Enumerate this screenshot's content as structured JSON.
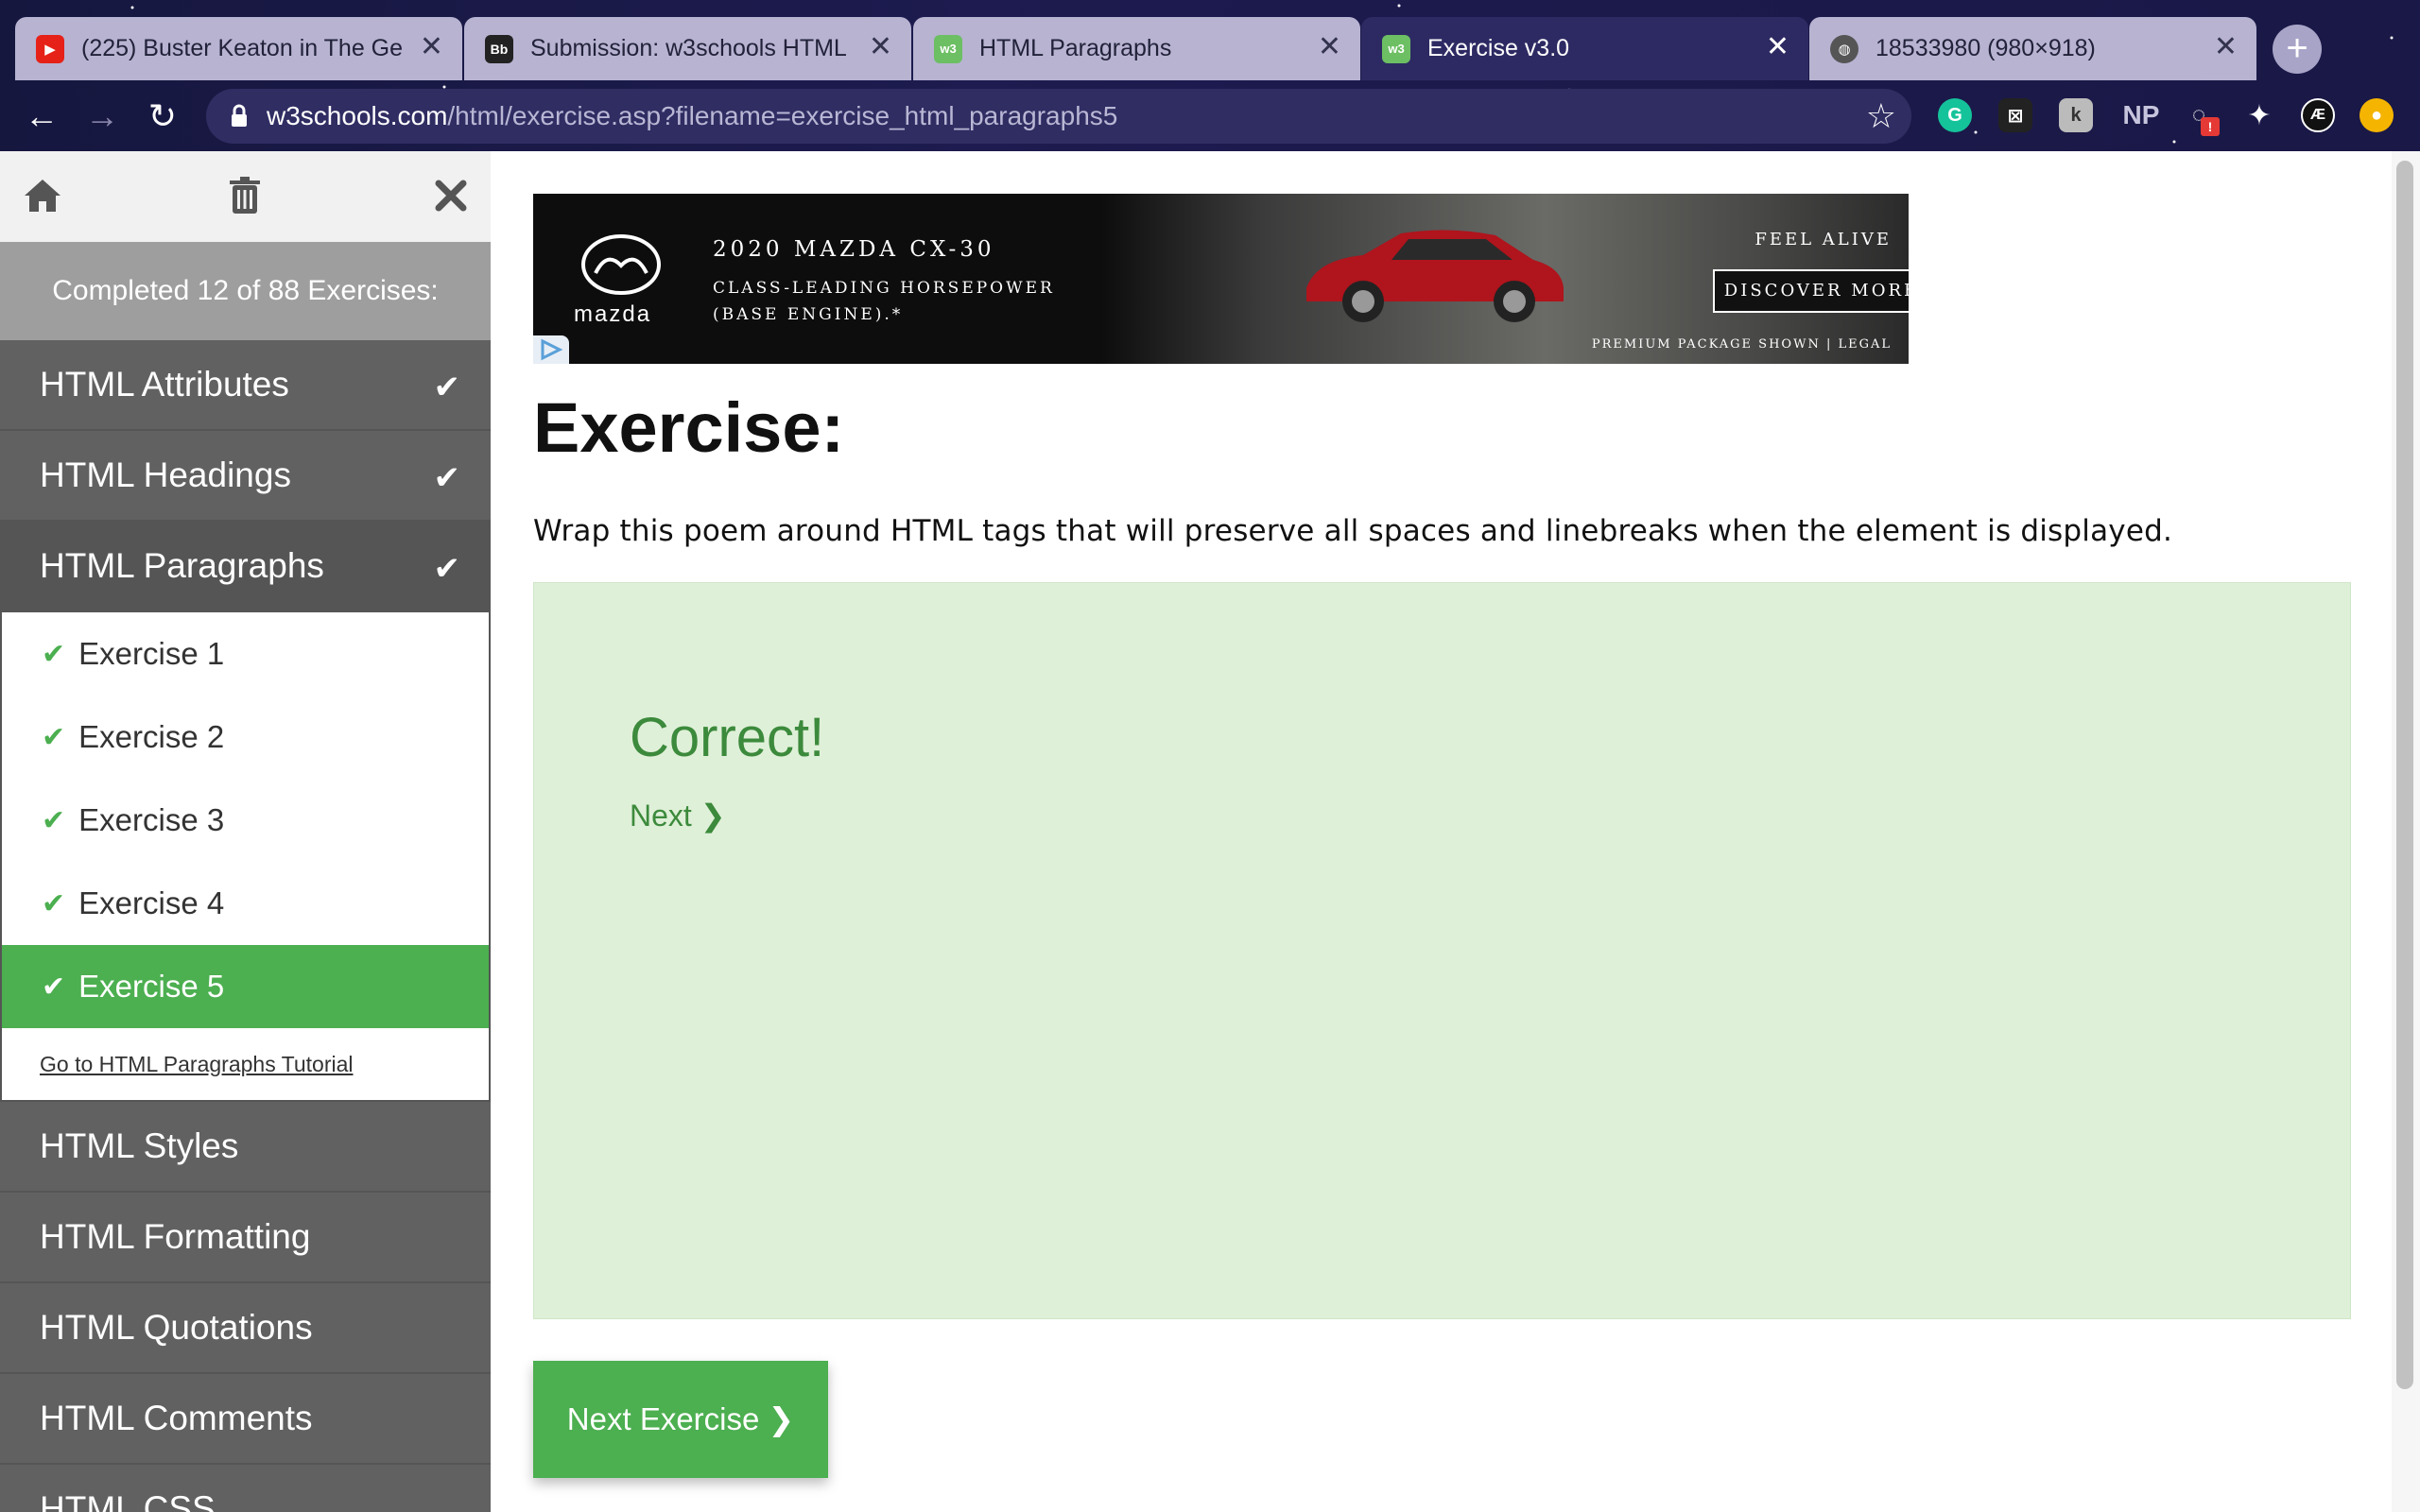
{
  "browser": {
    "tabs": [
      {
        "title": "(225) Buster Keaton in The Ge",
        "favicon": "youtube-icon",
        "active": false
      },
      {
        "title": "Submission: w3schools HTML",
        "favicon": "blackboard-icon",
        "active": false
      },
      {
        "title": "HTML Paragraphs",
        "favicon": "w3schools-icon",
        "active": false
      },
      {
        "title": "Exercise v3.0",
        "favicon": "w3schools-icon",
        "active": true
      },
      {
        "title": "18533980 (980×918)",
        "favicon": "globe-icon",
        "active": false
      }
    ],
    "url_domain": "w3schools.com",
    "url_path": "/html/exercise.asp?filename=exercise_html_paragraphs5",
    "extensions": [
      "grammarly-icon",
      "extension-icon",
      "extension-icon",
      "NP",
      "extension-alert-icon",
      "puzzle-icon",
      "extension-icon",
      "profile-icon"
    ],
    "ext_np_label": "NP",
    "ext_badge": "!"
  },
  "sidebar": {
    "completed_text": "Completed 12 of 88 Exercises:",
    "sections_top": [
      {
        "label": "HTML Attributes",
        "done": true
      },
      {
        "label": "HTML Headings",
        "done": true
      },
      {
        "label": "HTML Paragraphs",
        "done": true
      }
    ],
    "exercises": [
      {
        "label": "Exercise 1",
        "done": true,
        "selected": false
      },
      {
        "label": "Exercise 2",
        "done": true,
        "selected": false
      },
      {
        "label": "Exercise 3",
        "done": true,
        "selected": false
      },
      {
        "label": "Exercise 4",
        "done": true,
        "selected": false
      },
      {
        "label": "Exercise 5",
        "done": true,
        "selected": true
      }
    ],
    "tutorial_link": "Go to HTML Paragraphs Tutorial",
    "sections_bottom": [
      {
        "label": "HTML Styles"
      },
      {
        "label": "HTML Formatting"
      },
      {
        "label": "HTML Quotations"
      },
      {
        "label": "HTML Comments"
      },
      {
        "label": "HTML CSS"
      }
    ]
  },
  "ad": {
    "brand": "mazda",
    "headline": "2020 MAZDA CX-30",
    "subline": "CLASS-LEADING HORSEPOWER (BASE ENGINE).*",
    "tagline": "FEEL ALIVE",
    "cta": "DISCOVER MORE",
    "legal": "PREMIUM PACKAGE SHOWN | LEGAL"
  },
  "main": {
    "title": "Exercise:",
    "instruction": "Wrap this poem around HTML tags that will preserve all spaces and linebreaks when the element is displayed.",
    "result_text": "Correct!",
    "next_link": "Next ❯",
    "next_button": "Next Exercise ❯"
  },
  "colors": {
    "accent_green": "#4caf50",
    "success_bg": "#dff0d8",
    "success_text": "#3c8a3c",
    "sidebar_bg": "#616161"
  }
}
